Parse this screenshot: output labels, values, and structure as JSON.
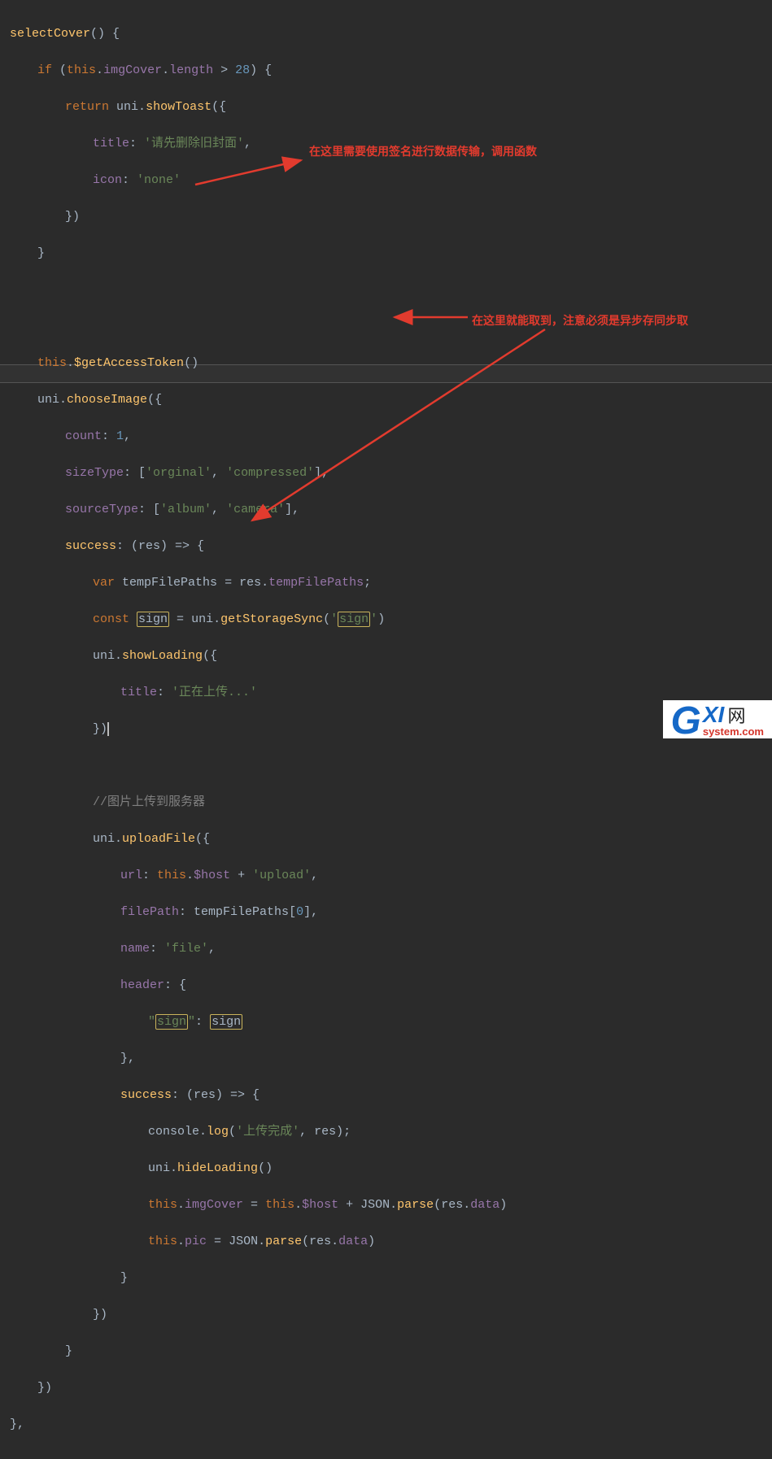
{
  "annotations": {
    "a1": "在这里需要使用签名进行数据传输，调用函数",
    "a2": "在这里就能取到，注意必须是异步存同步取"
  },
  "logo": {
    "g": "G",
    "xi": "XI",
    "wang": "网",
    "sys": "system.com"
  },
  "code": {
    "l1_fn": "selectCover",
    "l1_rest": "() {",
    "l2_if": "if",
    "l2_this": "this",
    "l2_imgCover": "imgCover",
    "l2_length": "length",
    "l2_op": ">",
    "l2_num": "28",
    "l3_return": "return",
    "l3_uni": "uni",
    "l3_showToast": "showToast",
    "l4_title": "title",
    "l4_titleval": "'请先删除旧封面'",
    "l5_icon": "icon",
    "l5_iconval": "'none'",
    "l6": "})",
    "l7": "}",
    "l9_this": "this",
    "l9_gat": "$getAccessToken",
    "l10_uni": "uni",
    "l10_ci": "chooseImage",
    "l11_count": "count",
    "l11_num": "1",
    "l12_sizeType": "sizeType",
    "l12_v1": "'orginal'",
    "l12_v2": "'compressed'",
    "l13_sourceType": "sourceType",
    "l13_v1": "'album'",
    "l13_v2": "'camera'",
    "l14_success": "success",
    "l14_res": "res",
    "l15_var": "var",
    "l15_tfp": "tempFilePaths",
    "l15_res": "res",
    "l16_const": "const",
    "l16_sign": "sign",
    "l16_uni": "uni",
    "l16_gss": "getStorageSync",
    "l16_arg": "'sign'",
    "l17_uni": "uni",
    "l17_sl": "showLoading",
    "l18_title": "title",
    "l18_val": "'正在上传...'",
    "l19": "})",
    "l21_cmt": "//图片上传到服务器",
    "l22_uni": "uni",
    "l22_uf": "uploadFile",
    "l23_url": "url",
    "l23_this": "this",
    "l23_host": "$host",
    "l23_plus": "+",
    "l23_val": "'upload'",
    "l24_fp": "filePath",
    "l24_tfp": "tempFilePaths",
    "l24_idx": "0",
    "l25_name": "name",
    "l25_val": "'file'",
    "l26_header": "header",
    "l27_k": "\"sign\"",
    "l27_v": "sign",
    "l28": "},",
    "l29_success": "success",
    "l29_res": "res",
    "l30_console": "console",
    "l30_log": "log",
    "l30_str": "'上传完成'",
    "l30_res": "res",
    "l31_uni": "uni",
    "l31_hl": "hideLoading",
    "l32_this": "this",
    "l32_ic": "imgCover",
    "l32_host": "$host",
    "l32_json": "JSON",
    "l32_parse": "parse",
    "l32_res": "res",
    "l32_data": "data",
    "l33_this": "this",
    "l33_pic": "pic",
    "l33_json": "JSON",
    "l33_parse": "parse",
    "l33_res": "res",
    "l33_data": "data",
    "l34": "}",
    "l35": "})",
    "l36": "}",
    "l37": "})",
    "l38": "},"
  }
}
